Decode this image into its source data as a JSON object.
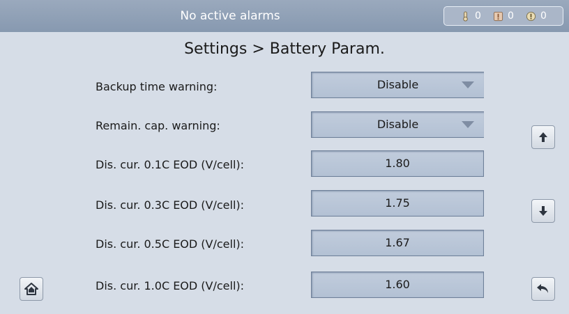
{
  "header": {
    "alarm_status": "No active alarms",
    "counts": {
      "critical": "0",
      "major": "0",
      "minor": "0"
    }
  },
  "page": {
    "title": "Settings > Battery Param."
  },
  "rows": [
    {
      "label": "Backup time warning:",
      "value": "Disable",
      "type": "dropdown"
    },
    {
      "label": "Remain. cap. warning:",
      "value": "Disable",
      "type": "dropdown"
    },
    {
      "label": "Dis. cur. 0.1C EOD (V/cell):",
      "value": "1.80",
      "type": "input"
    },
    {
      "label": "Dis. cur. 0.3C EOD (V/cell):",
      "value": "1.75",
      "type": "input"
    },
    {
      "label": "Dis. cur. 0.5C EOD (V/cell):",
      "value": "1.67",
      "type": "input"
    },
    {
      "label": "Dis. cur. 1.0C EOD (V/cell):",
      "value": "1.60",
      "type": "input"
    }
  ],
  "icons": {
    "alarm_1": "thermometer-alarm-icon",
    "alarm_2": "exclamation-square-icon",
    "alarm_3": "exclamation-circle-icon",
    "scroll_up": "arrow-up-icon",
    "scroll_down": "arrow-down-icon",
    "home": "home-icon",
    "back": "back-arrow-icon"
  },
  "colors": {
    "background": "#d6dde7",
    "header": "#8fa0b6",
    "field": "#b9c6d8"
  }
}
